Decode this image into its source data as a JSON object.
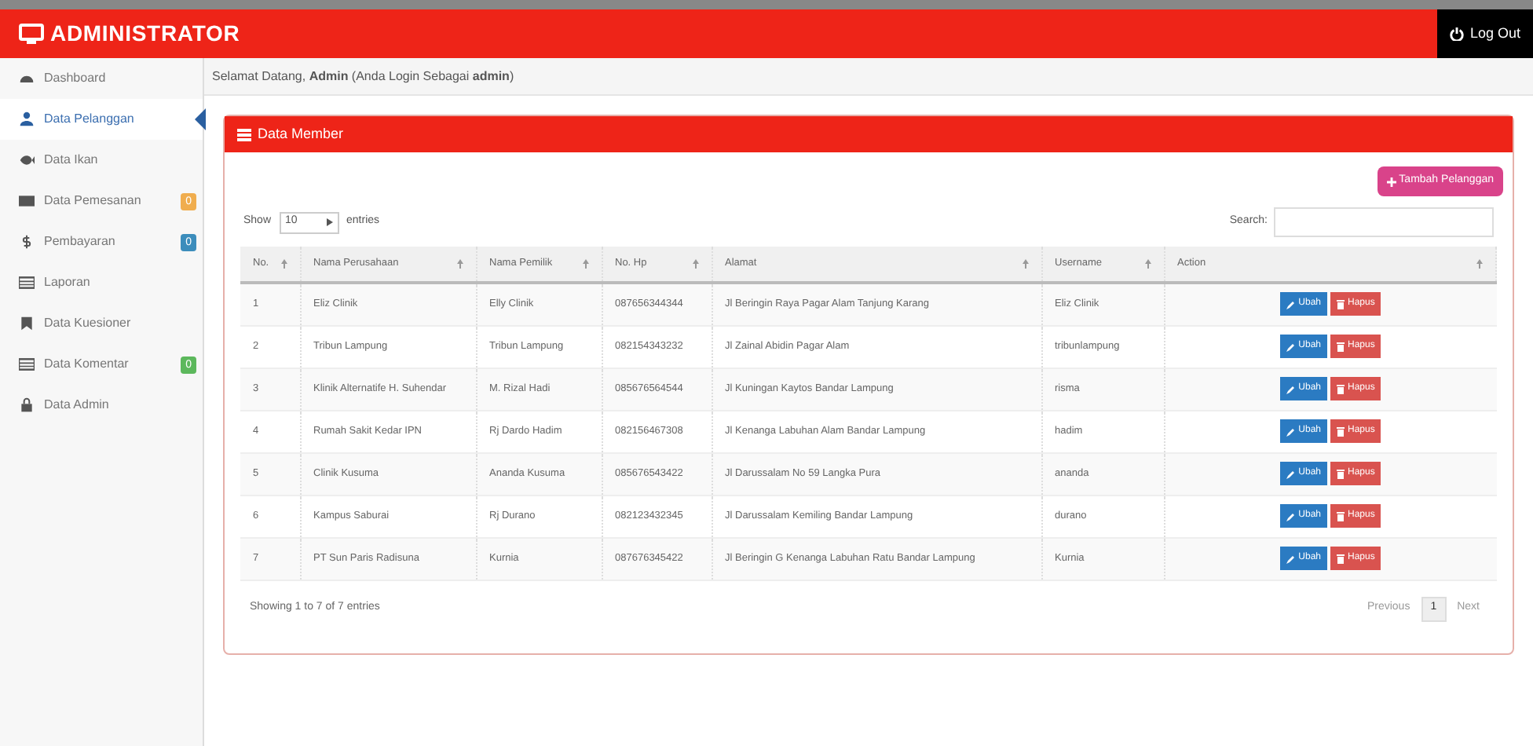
{
  "header": {
    "title": "ADMINISTRATOR",
    "logout": "Log Out"
  },
  "sidebar": {
    "items": [
      {
        "label": "Dashboard",
        "selected": false
      },
      {
        "label": "Data Pelanggan",
        "selected": true
      },
      {
        "label": "Data Ikan",
        "selected": false
      },
      {
        "label": "Data Pemesanan",
        "selected": false,
        "badge": "0",
        "color": "#f0ad4e"
      },
      {
        "label": "Pembayaran",
        "selected": false,
        "badge": "0",
        "color": "#3c8dbc"
      },
      {
        "label": "Laporan",
        "selected": false
      },
      {
        "label": "Data Kuesioner",
        "selected": false
      },
      {
        "label": "Data Komentar",
        "selected": false,
        "badge": "0",
        "color": "#5cb85c"
      },
      {
        "label": "Data Admin",
        "selected": false
      }
    ]
  },
  "welcome": "Selamat Datang, **Admin** (Anda Login Sebagai **admin**)",
  "panel": {
    "title": "Data Member",
    "add_button": "Tambah Pelanggan",
    "show_label": "Show",
    "show_value": "10",
    "entries_label": "entries",
    "search_label": "Search:",
    "table": {
      "columns": [
        "No.",
        "Nama Perusahaan",
        "Nama Pemilik",
        "No. Hp",
        "Alamat",
        "Username",
        "Action"
      ],
      "rows": [
        {
          "cells": [
            "1",
            "Eliz Clinik",
            "Elly Clinik",
            "087656344344",
            "Jl Beringin Raya Pagar Alam Tanjung Karang",
            "Eliz Clinik"
          ],
          "edit": "Ubah",
          "delete": "Hapus"
        },
        {
          "cells": [
            "2",
            "Tribun Lampung",
            "Tribun Lampung",
            "082154343232",
            "Jl Zainal Abidin Pagar Alam",
            "tribunlampung"
          ],
          "edit": "Ubah",
          "delete": "Hapus"
        },
        {
          "cells": [
            "3",
            "Klinik Alternatife H. Suhendar",
            "M. Rizal Hadi",
            "085676564544",
            "Jl Kuningan Kaytos Bandar Lampung",
            "risma"
          ],
          "edit": "Ubah",
          "delete": "Hapus"
        },
        {
          "cells": [
            "4",
            "Rumah Sakit Kedar IPN",
            "Rj Dardo Hadim",
            "082156467308",
            "Jl Kenanga Labuhan Alam Bandar Lampung",
            "hadim"
          ],
          "edit": "Ubah",
          "delete": "Hapus"
        },
        {
          "cells": [
            "5",
            "Clinik Kusuma",
            "Ananda Kusuma",
            "085676543422",
            "Jl Darussalam No 59 Langka Pura",
            "ananda"
          ],
          "edit": "Ubah",
          "delete": "Hapus"
        },
        {
          "cells": [
            "6",
            "Kampus Saburai",
            "Rj Durano",
            "082123432345",
            "Jl Darussalam Kemiling Bandar Lampung",
            "durano"
          ],
          "edit": "Ubah",
          "delete": "Hapus"
        },
        {
          "cells": [
            "7",
            "PT Sun Paris Radisuna",
            "Kurnia",
            "087676345422",
            "Jl Beringin G Kenanga Labuhan Ratu Bandar Lampung",
            "Kurnia"
          ],
          "edit": "Ubah",
          "delete": "Hapus"
        }
      ]
    },
    "info": "Showing 1 to 7 of 7 entries",
    "pagination": [
      {
        "label": "Previous",
        "selected": false
      },
      {
        "label": "1",
        "selected": true
      },
      {
        "label": "Next",
        "selected": false
      }
    ]
  }
}
